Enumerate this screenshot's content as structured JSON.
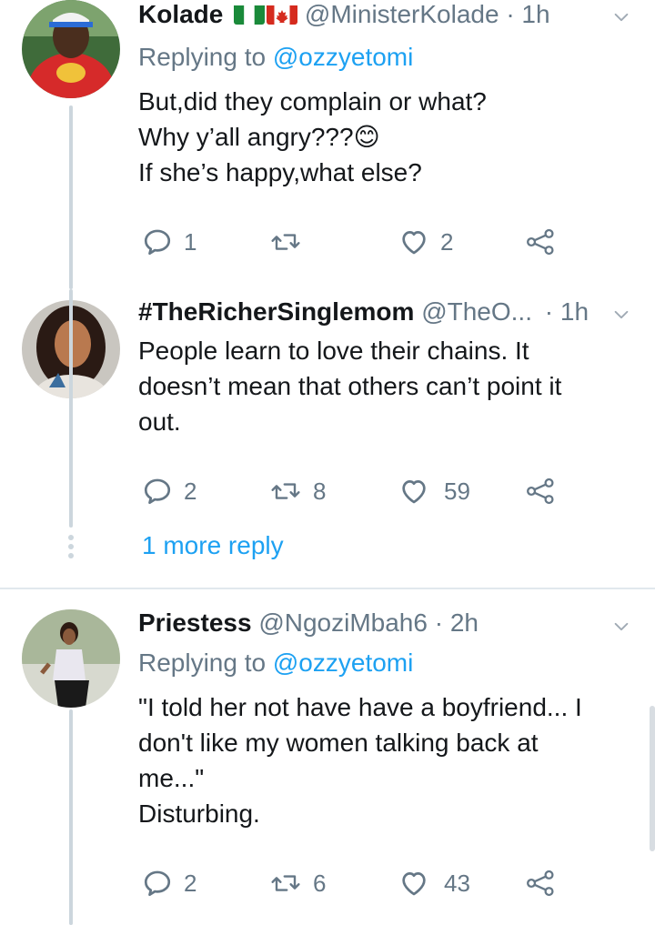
{
  "tweets": [
    {
      "name": "Kolade",
      "handle": "@MinisterKolade",
      "time": "· 1h",
      "replying_label": "Replying to",
      "replying_to": "@ozzyetomi",
      "lines": [
        "But,did they complain or what?",
        "Why y’all angry???😊",
        "If she’s happy,what else?"
      ],
      "reply_count": "1",
      "retweet_count": "",
      "like_count": "2"
    },
    {
      "name": "#TheRicherSinglemom",
      "handle": "@TheO...",
      "time": "· 1h",
      "lines": [
        "People learn to love their chains. It",
        "doesn’t mean that others can’t point it",
        "out."
      ],
      "reply_count": "2",
      "retweet_count": "8",
      "like_count": "59"
    },
    {
      "name": "Priestess",
      "handle": "@NgoziMbah6",
      "time": "· 2h",
      "replying_label": "Replying to",
      "replying_to": "@ozzyetomi",
      "lines": [
        "\"I told her not have have a boyfriend...  I",
        "don't like my women talking back at",
        "me...\"",
        "Disturbing."
      ],
      "reply_count": "2",
      "retweet_count": "6",
      "like_count": "43"
    }
  ],
  "more_replies": "1 more reply",
  "icons": [
    "reply-icon",
    "retweet-icon",
    "like-icon",
    "share-icon",
    "chevron-down-icon"
  ],
  "colors": {
    "link": "#1da1f2",
    "muted": "#657786",
    "thread": "#ccd6dd",
    "text": "#14171a"
  }
}
